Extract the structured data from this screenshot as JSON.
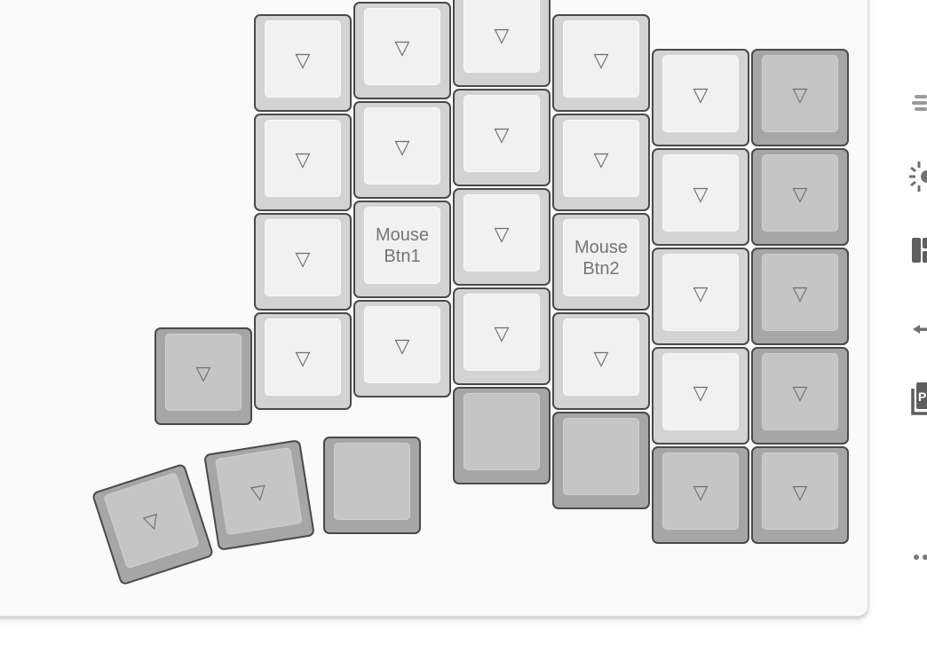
{
  "keyboard": {
    "keys": [
      {
        "id": "r0c1",
        "label": "▽",
        "tone": "light"
      },
      {
        "id": "r1c1",
        "label": "▽",
        "tone": "light"
      },
      {
        "id": "r2c1",
        "label": "▽",
        "tone": "light"
      },
      {
        "id": "r3c1",
        "label": "▽",
        "tone": "light"
      },
      {
        "id": "r0c2",
        "label": "▽",
        "tone": "light"
      },
      {
        "id": "r1c2",
        "label": "▽",
        "tone": "light"
      },
      {
        "id": "r2c2",
        "label": "Mouse\nBtn1",
        "tone": "light"
      },
      {
        "id": "r3c2",
        "label": "▽",
        "tone": "light"
      },
      {
        "id": "r0c3",
        "label": "▽",
        "tone": "light"
      },
      {
        "id": "r1c3",
        "label": "▽",
        "tone": "light"
      },
      {
        "id": "r2c3",
        "label": "▽",
        "tone": "light"
      },
      {
        "id": "r3c3",
        "label": "▽",
        "tone": "light"
      },
      {
        "id": "r4c3",
        "label": "",
        "tone": "dark"
      },
      {
        "id": "r0c4",
        "label": "▽",
        "tone": "light"
      },
      {
        "id": "r1c4",
        "label": "▽",
        "tone": "light"
      },
      {
        "id": "r2c4",
        "label": "Mouse\nBtn2",
        "tone": "light"
      },
      {
        "id": "r3c4",
        "label": "▽",
        "tone": "light"
      },
      {
        "id": "r4c4",
        "label": "",
        "tone": "dark"
      },
      {
        "id": "r0c5",
        "label": "▽",
        "tone": "light"
      },
      {
        "id": "r1c5",
        "label": "▽",
        "tone": "light"
      },
      {
        "id": "r2c5",
        "label": "▽",
        "tone": "light"
      },
      {
        "id": "r3c5",
        "label": "▽",
        "tone": "light"
      },
      {
        "id": "r4c5",
        "label": "▽",
        "tone": "dark"
      },
      {
        "id": "r0c6",
        "label": "▽",
        "tone": "dark"
      },
      {
        "id": "r1c6",
        "label": "▽",
        "tone": "dark"
      },
      {
        "id": "r2c6",
        "label": "▽",
        "tone": "dark"
      },
      {
        "id": "r3c6",
        "label": "▽",
        "tone": "dark"
      },
      {
        "id": "r4c6",
        "label": "▽",
        "tone": "dark"
      },
      {
        "id": "r3c0",
        "label": "▽",
        "tone": "dark"
      },
      {
        "id": "th0",
        "label": "▽",
        "tone": "dark"
      },
      {
        "id": "th1",
        "label": "▽",
        "tone": "dark"
      },
      {
        "id": "th2",
        "label": "",
        "tone": "dark"
      }
    ]
  },
  "sidebar": {
    "icons": [
      "lines-icon",
      "lighting-icon",
      "layout-icon",
      "swap-icon",
      "macro-icon",
      "more-icon"
    ]
  },
  "colors": {
    "key_border": "#4a4a4a",
    "light_key": "#d3d3d3",
    "light_cap": "#f1f1f1",
    "dark_key": "#a6a6a6",
    "dark_cap": "#c5c5c5",
    "icon": "#7a7a7a"
  }
}
